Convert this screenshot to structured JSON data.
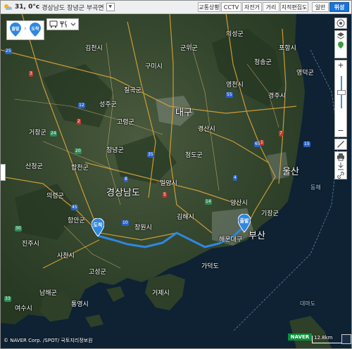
{
  "colors": {
    "route": "#2f87e0",
    "accent": "#1a73d9",
    "pin": "#2f87e0",
    "naver_green": "#0b8f3b",
    "sea": "#0d1f2f"
  },
  "weather": {
    "icon": "sun-cloud-icon",
    "temperature": "31, 0°c",
    "location": "경상남도 창녕군 부곡면"
  },
  "toolbar": {
    "traffic": "교통상황",
    "cctv": "CCTV",
    "bike": "자전거",
    "distance": "거리",
    "cadastral": "지적편집도",
    "normal": "일반",
    "satellite": "위성"
  },
  "route_panel": {
    "start": "출발",
    "arrive": "도착"
  },
  "map": {
    "pins": [
      {
        "label": "도착"
      },
      {
        "label": "출발"
      }
    ],
    "labels": [
      "경상남도",
      "대구",
      "울산",
      "부산",
      "구미시",
      "칠곡군",
      "영천시",
      "경산시",
      "청도군",
      "밀양시",
      "양산시",
      "창녕군",
      "김해시",
      "창원시",
      "함안군",
      "의령군",
      "진주시",
      "통영시",
      "거제시",
      "고성군",
      "경주시",
      "포항시",
      "합천군",
      "고령군",
      "성주군",
      "사천시",
      "남해군",
      "여수시",
      "기장군",
      "가덕도",
      "대마도",
      "동해",
      "해운대구",
      "김천시",
      "군위군",
      "의성군",
      "청송군",
      "영덕군",
      "거창군",
      "산청군"
    ],
    "shields": [
      "25",
      "35",
      "45",
      "55",
      "65",
      "10",
      "14",
      "20",
      "24",
      "30",
      "33",
      "1",
      "7",
      "2",
      "3",
      "5",
      "4",
      "8",
      "12",
      "15"
    ]
  },
  "attribution": "© NAVER Corp. /SPOT/ 국토지리정보원",
  "logo": "NAVER",
  "scale": "12.8km"
}
